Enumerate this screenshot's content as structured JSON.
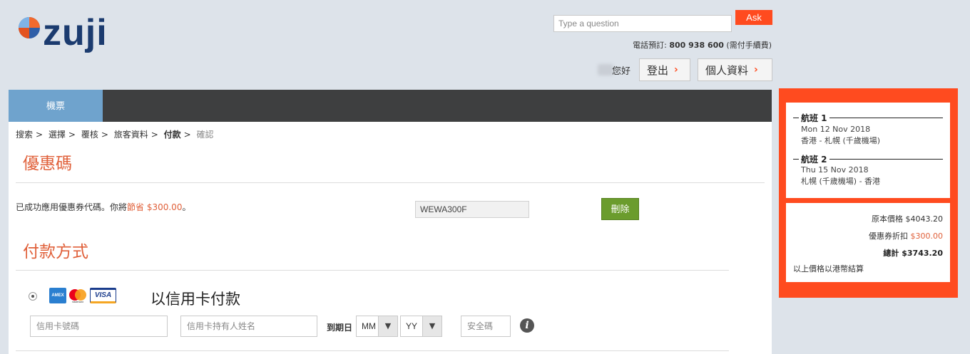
{
  "header": {
    "logo_text": "zuji",
    "search_placeholder": "Type a question",
    "ask_label": "Ask",
    "phone_prefix": "電話預訂: ",
    "phone_number": "800 938 600",
    "phone_suffix": " (需付手續費)",
    "greeting": "您好",
    "logout_label": "登出",
    "profile_label": "個人資料"
  },
  "tabs": {
    "flights": "機票"
  },
  "breadcrumb": [
    "搜索",
    "選擇",
    "覆核",
    "旅客資料",
    "付款",
    "確認"
  ],
  "breadcrumb_sep": ">",
  "promo": {
    "title": "優惠碼",
    "message_prefix": "已成功應用優惠券代碼。你將",
    "message_saved": "節省 $300.00",
    "message_suffix": "。",
    "code_value": "WEWA300F",
    "delete_label": "刪除"
  },
  "payment": {
    "title": "付款方式",
    "method_label": "以信用卡付款",
    "card_logos": [
      "AMEX",
      "mastercard",
      "VISA"
    ],
    "card_number_placeholder": "信用卡號碼",
    "card_holder_placeholder": "信用卡持有人姓名",
    "expiry_label": "到期日",
    "month_value": "MM",
    "year_value": "YY",
    "cvv_placeholder": "安全碼",
    "info_icon": "i"
  },
  "summary": {
    "flight1_head": "航班 1",
    "flight1_date": "Mon 12 Nov 2018",
    "flight1_route": "香港 - 札幌 (千歲機場)",
    "flight2_head": "航班 2",
    "flight2_date": "Thu 15 Nov 2018",
    "flight2_route": "札幌 (千歲機場) - 香港",
    "original_label": "原本價格",
    "original_amount": "$4043.20",
    "discount_label": "優惠券折扣",
    "discount_amount": "$300.00",
    "total_label": "總計",
    "total_amount": "$3743.20",
    "currency_note": "以上價格以港幣結算"
  },
  "colors": {
    "accent": "#ff4b1f",
    "title": "#e0603a",
    "tab_active": "#6fa3cd",
    "tabbar": "#3e3f40",
    "delete_btn": "#6b9c2d"
  }
}
